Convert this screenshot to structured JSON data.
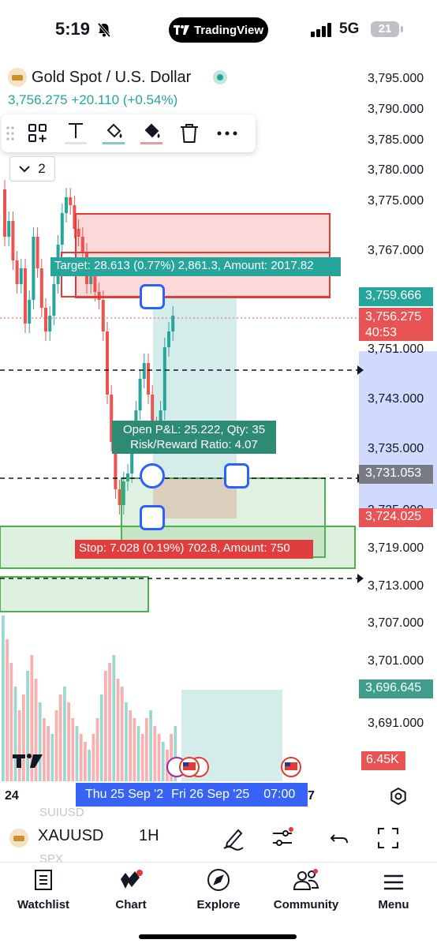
{
  "status_bar": {
    "time": "5:19",
    "brand": "TradingView",
    "network": "5G",
    "battery": "21"
  },
  "symbol": {
    "title": "Gold Spot / U.S. Dollar",
    "price": "3,756.275",
    "change": "+20.110",
    "change_pct": "(+0.54%)",
    "indicators_count": "2"
  },
  "toolbar": {
    "icons": [
      "drag-grip-icon",
      "add-widget-icon",
      "text-icon",
      "fill-color-icon",
      "stroke-color-icon",
      "trash-icon",
      "more-icon"
    ]
  },
  "position": {
    "target_text": "Target: 28.613 (0.77%) 2,861.3, Amount: 2017.82",
    "pnl_line1": "Open P&L: 25.222, Qty: 35",
    "pnl_line2": "Risk/Reward Ratio: 4.07",
    "stop_text": "Stop: 7.028 (0.19%) 702.8, Amount: 750"
  },
  "price_axis": {
    "ticks": [
      "3,795.000",
      "3,790.000",
      "3,785.000",
      "3,780.000",
      "3,775.000",
      "3,767.000",
      "3,751.000",
      "3,743.000",
      "3,735.000",
      "3,725.000",
      "3,719.000",
      "3,713.000",
      "3,707.000",
      "3,701.000",
      "3,691.000"
    ],
    "badge_target": "3,759.666",
    "badge_price": "3,756.275",
    "badge_countdown": "40:53",
    "badge_entry": "3,731.053",
    "badge_stop": "3,724.025",
    "badge_volume_price": "3,696.645"
  },
  "volume": {
    "value": "6.45K"
  },
  "time_axis": {
    "left_label": "24",
    "range_start": "Thu 25 Sep '2",
    "range_end": "Fri 26 Sep '25",
    "range_time": "07:00",
    "right_label": "7"
  },
  "watchlist_ghost": [
    "SUIUSD",
    "SPX"
  ],
  "bottom_toolbar": {
    "symbol": "XAUUSD",
    "interval": "1H"
  },
  "tabs": [
    {
      "label": "Watchlist",
      "icon": "watchlist-icon"
    },
    {
      "label": "Chart",
      "icon": "chart-icon"
    },
    {
      "label": "Explore",
      "icon": "compass-icon"
    },
    {
      "label": "Community",
      "icon": "community-icon"
    },
    {
      "label": "Menu",
      "icon": "menu-icon"
    }
  ],
  "colors": {
    "up": "#26a69a",
    "down": "#ef5350",
    "accent": "#2962ff",
    "stop": "#e03e3e"
  }
}
